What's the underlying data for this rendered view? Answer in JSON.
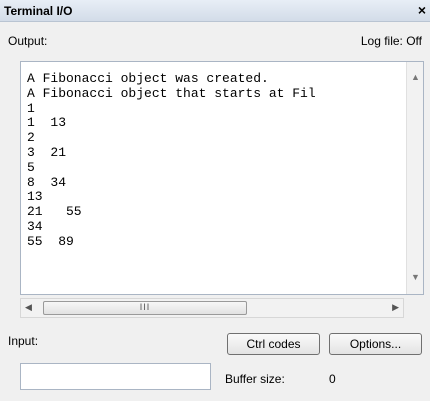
{
  "window": {
    "title": "Terminal I/O",
    "close_glyph": "×"
  },
  "output": {
    "label": "Output:",
    "log_file": "Log file: Off",
    "lines": [
      "A Fibonacci object was created.",
      "A Fibonacci object that starts at Fil",
      "1",
      "1  13",
      "2",
      "3  21",
      "5",
      "8  34",
      "13",
      "21   55",
      "34",
      "55  89"
    ]
  },
  "scrollbar": {
    "thumb_grip": "III"
  },
  "input": {
    "label": "Input:",
    "value": ""
  },
  "buttons": {
    "ctrl_codes": "Ctrl codes",
    "options": "Options..."
  },
  "buffer": {
    "label": "Buffer size:",
    "value": "0"
  }
}
